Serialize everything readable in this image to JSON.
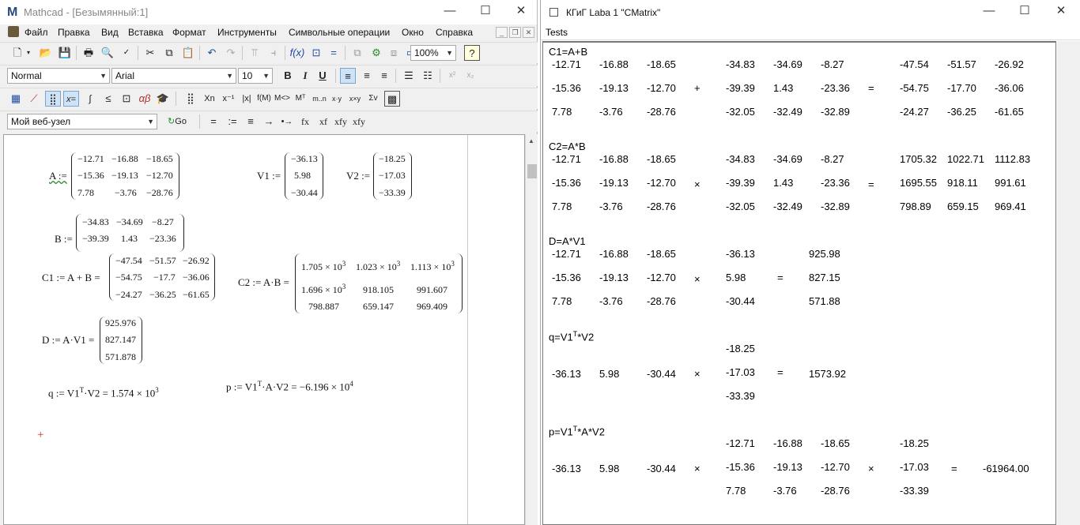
{
  "mathcad": {
    "title": "Mathcad - [Безымянный:1]",
    "menu": [
      "Файл",
      "Правка",
      "Вид",
      "Вставка",
      "Формат",
      "Инструменты",
      "Символьные операции",
      "Окно",
      "Справка"
    ],
    "zoom": "100%",
    "style": "Normal",
    "font": "Arial",
    "font_size": "10",
    "web_node": "Мой веб-узел",
    "go_label": "Go",
    "toolbar4": [
      "=",
      ":=",
      "≡",
      "→",
      "•→",
      "fx",
      "xf",
      "xfy",
      "xfy"
    ],
    "ws": {
      "A_label": "A :=",
      "A": [
        [
          "−12.71",
          "−16.88",
          "−18.65"
        ],
        [
          "−15.36",
          "−19.13",
          "−12.70"
        ],
        [
          "7.78",
          "−3.76",
          "−28.76"
        ]
      ],
      "V1_label": "V1 :=",
      "V1": [
        "−36.13",
        "5.98",
        "−30.44"
      ],
      "V2_label": "V2 :=",
      "V2": [
        "−18.25",
        "−17.03",
        "−33.39"
      ],
      "B_label": "B :=",
      "B": [
        [
          "−34.83",
          "−34.69",
          "−8.27"
        ],
        [
          "−39.39",
          "1.43",
          "−23.36"
        ]
      ],
      "C1_label": "C1 := A + B =",
      "C1": [
        [
          "−47.54",
          "−51.57",
          "−26.92"
        ],
        [
          "−54.75",
          "−17.7",
          "−36.06"
        ],
        [
          "−24.27",
          "−36.25",
          "−61.65"
        ]
      ],
      "C2_label": "C2 := A·B =",
      "C2": [
        [
          "1.705 × 10",
          "1.023 × 10",
          "1.113 × 10"
        ],
        [
          "1.696 × 10",
          "918.105",
          "991.607"
        ],
        [
          "798.887",
          "659.147",
          "969.409"
        ]
      ],
      "C2_exp": "3",
      "D_label": "D := A·V1 =",
      "D": [
        "925.976",
        "827.147",
        "571.878"
      ],
      "q_expr": "q := V1",
      "q_sup": "T",
      "q_rest": "·V2 = 1.574 × 10",
      "q_exp": "3",
      "p_expr": "p := V1",
      "p_sup": "T",
      "p_rest": "·A·V2 = −6.196 × 10",
      "p_exp": "4",
      "cursor": "+"
    }
  },
  "cmatrix": {
    "title": "КГиГ Laba 1 \"CMatrix\"",
    "menu": "Tests",
    "sections": {
      "c1_header": "C1=A+B",
      "c2_header": "C2=A*B",
      "d_header": "D=A*V1",
      "q_header": "q=V1",
      "q_header_sup": "T",
      "q_header_rest": "*V2",
      "p_header": "p=V1",
      "p_header_sup": "T",
      "p_header_rest": "*A*V2"
    },
    "A": [
      [
        "-12.71",
        "-16.88",
        "-18.65"
      ],
      [
        "-15.36",
        "-19.13",
        "-12.70"
      ],
      [
        "7.78",
        "-3.76",
        "-28.76"
      ]
    ],
    "B": [
      [
        "-34.83",
        "-34.69",
        "-8.27"
      ],
      [
        "-39.39",
        "1.43",
        "-23.36"
      ],
      [
        "-32.05",
        "-32.49",
        "-32.89"
      ]
    ],
    "C1": [
      [
        "-47.54",
        "-51.57",
        "-26.92"
      ],
      [
        "-54.75",
        "-17.70",
        "-36.06"
      ],
      [
        "-24.27",
        "-36.25",
        "-61.65"
      ]
    ],
    "C2": [
      [
        "1705.32",
        "1022.71",
        "1112.83"
      ],
      [
        "1695.55",
        "918.11",
        "991.61"
      ],
      [
        "798.89",
        "659.15",
        "969.41"
      ]
    ],
    "V1": [
      "-36.13",
      "5.98",
      "-30.44"
    ],
    "D": [
      "925.98",
      "827.15",
      "571.88"
    ],
    "V1T": [
      "-36.13",
      "5.98",
      "-30.44"
    ],
    "V2": [
      "-18.25",
      "-17.03",
      "-33.39"
    ],
    "q": "1573.92",
    "p": "-61964.00",
    "ops": {
      "plus": "+",
      "times": "×",
      "eq": "="
    }
  }
}
